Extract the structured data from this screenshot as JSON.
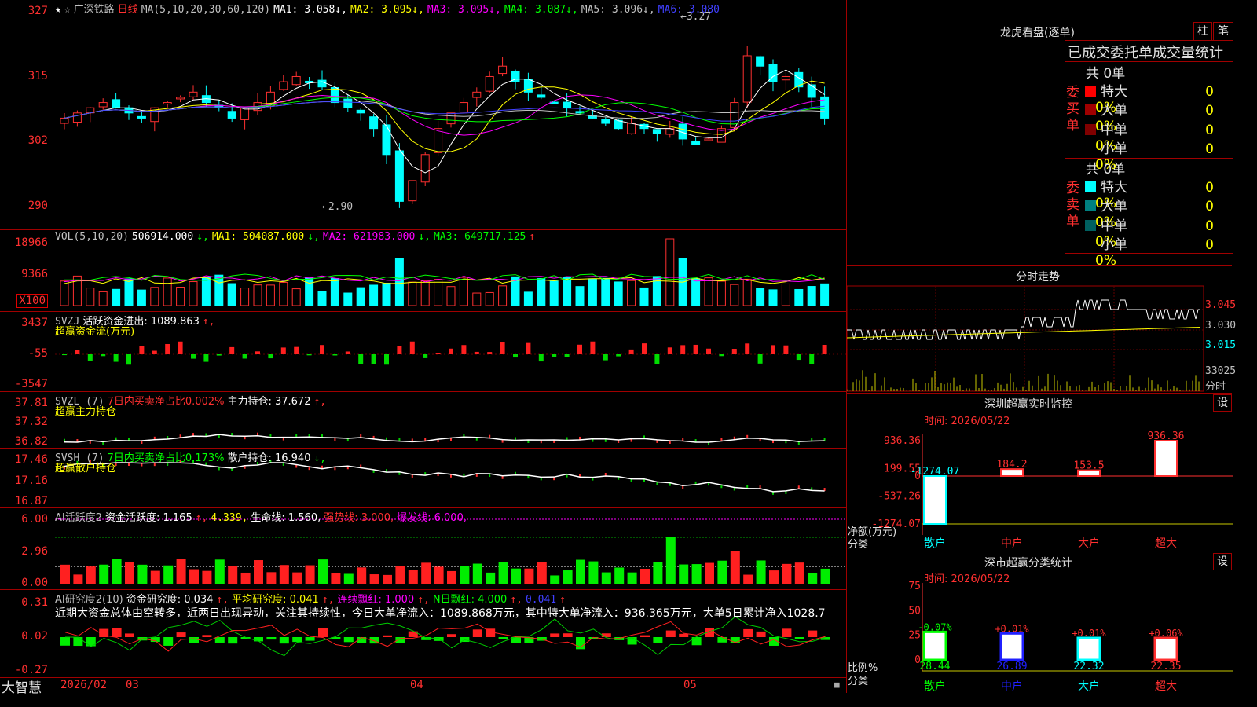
{
  "stock": {
    "name": "广深铁路",
    "period": "日线",
    "ma_header": "MA(5,10,20,30,60,120)",
    "ma_values": [
      {
        "label": "MA1:",
        "value": "3.058",
        "arrow": "↓",
        "color": "#ffffff"
      },
      {
        "label": "MA2:",
        "value": "3.095",
        "arrow": "↓",
        "color": "#ffff00"
      },
      {
        "label": "MA3:",
        "value": "3.095",
        "arrow": "↓",
        "color": "#ff00ff"
      },
      {
        "label": "MA4:",
        "value": "3.087",
        "arrow": "↓",
        "color": "#00ff00"
      },
      {
        "label": "MA5:",
        "value": "3.096",
        "arrow": "↓",
        "color": "#c0c0c0"
      },
      {
        "label": "MA6:",
        "value": "3.080",
        "arrow": "",
        "color": "#4040ff"
      }
    ],
    "price_ticks": [
      "327",
      "315",
      "302",
      "290"
    ],
    "high_label": "3.27",
    "low_label": "2.90"
  },
  "volume": {
    "header": "VOL(5,10,20)",
    "value": "506914.000",
    "ma1": "MA1: 504087.000",
    "ma2": "MA2: 621983.000",
    "ma3": "MA3: 649717.125",
    "ticks": [
      "18966",
      "9366"
    ],
    "unit": "X100"
  },
  "svzj": {
    "header": "SVZJ",
    "label": "活跃资金进出: 1089.863",
    "sub": "超赢资金流(万元)",
    "ticks": [
      "3437",
      "-55",
      "-3547"
    ]
  },
  "svzl": {
    "header": "SVZL (7)",
    "label1": "7日内买卖净占比0.002%",
    "label2": "主力持仓: 37.672",
    "sub": "超赢主力持仓",
    "ticks": [
      "37.81",
      "37.32",
      "36.82"
    ]
  },
  "svsh": {
    "header": "SVSH (7)",
    "label1": "7日内买卖净占比0.173%",
    "label2": "散户持仓: 16.940",
    "sub": "超赢散户持仓",
    "ticks": [
      "17.46",
      "17.16",
      "16.87"
    ]
  },
  "ai1": {
    "header": "AI活跃度2",
    "label1": "资金活跃度: 1.165",
    "label1b": "4.339,",
    "label2": "生命线: 1.560,",
    "label3": "强势线: 3.000,",
    "label4": "爆发线: 6.000,",
    "ticks": [
      "6.00",
      "2.96",
      "0.00"
    ]
  },
  "ai2": {
    "header": "AI研究度2(10)",
    "label1": "资金研究度: 0.034",
    "label2": "平均研究度: 0.041",
    "label3": "连续飘红: 1.000",
    "label4": "N日飘红: 4.000",
    "label5": "0.041",
    "commentary": "近期大资金总体由空转多，近两日出现异动，关注其持续性，今日大单净流入：1089.868万元，其中特大单净流入：936.365万元，大单5日累计净入1028.7",
    "ticks": [
      "0.31",
      "0.02",
      "-0.27"
    ]
  },
  "footer": {
    "brand": "大智慧",
    "dates": [
      "2026/02",
      "03",
      "04",
      "05"
    ]
  },
  "lhb": {
    "title": "龙虎看盘(逐单)",
    "btn1": "柱",
    "btn2": "笔",
    "tabs": "已成交委托单成交量统计",
    "buy_side": "委买单",
    "sell_side": "委卖单",
    "buy_total": "共 0单",
    "sell_total": "共 0单",
    "buy_rows": [
      {
        "name": "特大",
        "count": "0",
        "pct": "0%",
        "color": "#ff0000"
      },
      {
        "name": "大单",
        "count": "0",
        "pct": "0%",
        "color": "#a00000"
      },
      {
        "name": "中单",
        "count": "0",
        "pct": "0%",
        "color": "#800000"
      },
      {
        "name": "小单",
        "count": "0",
        "pct": "0%",
        "color": ""
      }
    ],
    "sell_rows": [
      {
        "name": "特大",
        "count": "0",
        "pct": "0%",
        "color": "#00ffff"
      },
      {
        "name": "大单",
        "count": "0",
        "pct": "0%",
        "color": "#008080"
      },
      {
        "name": "中单",
        "count": "0",
        "pct": "0%",
        "color": "#006060"
      },
      {
        "name": "小单",
        "count": "0",
        "pct": "0%",
        "color": ""
      }
    ]
  },
  "intraday": {
    "title": "分时走势",
    "prices": [
      "3.045",
      "3.030",
      "3.015"
    ],
    "vol_label": "33025",
    "sub_label": "分时"
  },
  "monitor": {
    "title": "深圳超赢实时监控",
    "btn": "设",
    "time": "时间: 2026/05/22",
    "ticks": [
      "936.36",
      "199.55",
      "0",
      "-537.26",
      "-1274.07"
    ],
    "ylabel": "净额(万元)",
    "xlabel": "分类",
    "categories": [
      "散户",
      "中户",
      "大户",
      "超大"
    ],
    "values": [
      -1274.07,
      184.2,
      153.5,
      936.36
    ],
    "value_labels": [
      "-1274.07",
      "184.2",
      "153.5",
      "936.36"
    ]
  },
  "classify": {
    "title": "深市超赢分类统计",
    "btn": "设",
    "time": "时间: 2026/05/22",
    "ticks": [
      "75",
      "50",
      "25",
      "0"
    ],
    "ylabel": "比例%",
    "xlabel": "分类",
    "categories": [
      "散户",
      "中户",
      "大户",
      "超大"
    ],
    "values": [
      28.44,
      26.89,
      22.32,
      22.35
    ],
    "value_labels": [
      "28.44",
      "26.89",
      "22.32",
      "22.35"
    ],
    "changes": [
      "-0.07%",
      "+0.01%",
      "+0.01%",
      "+0.06%"
    ]
  }
}
